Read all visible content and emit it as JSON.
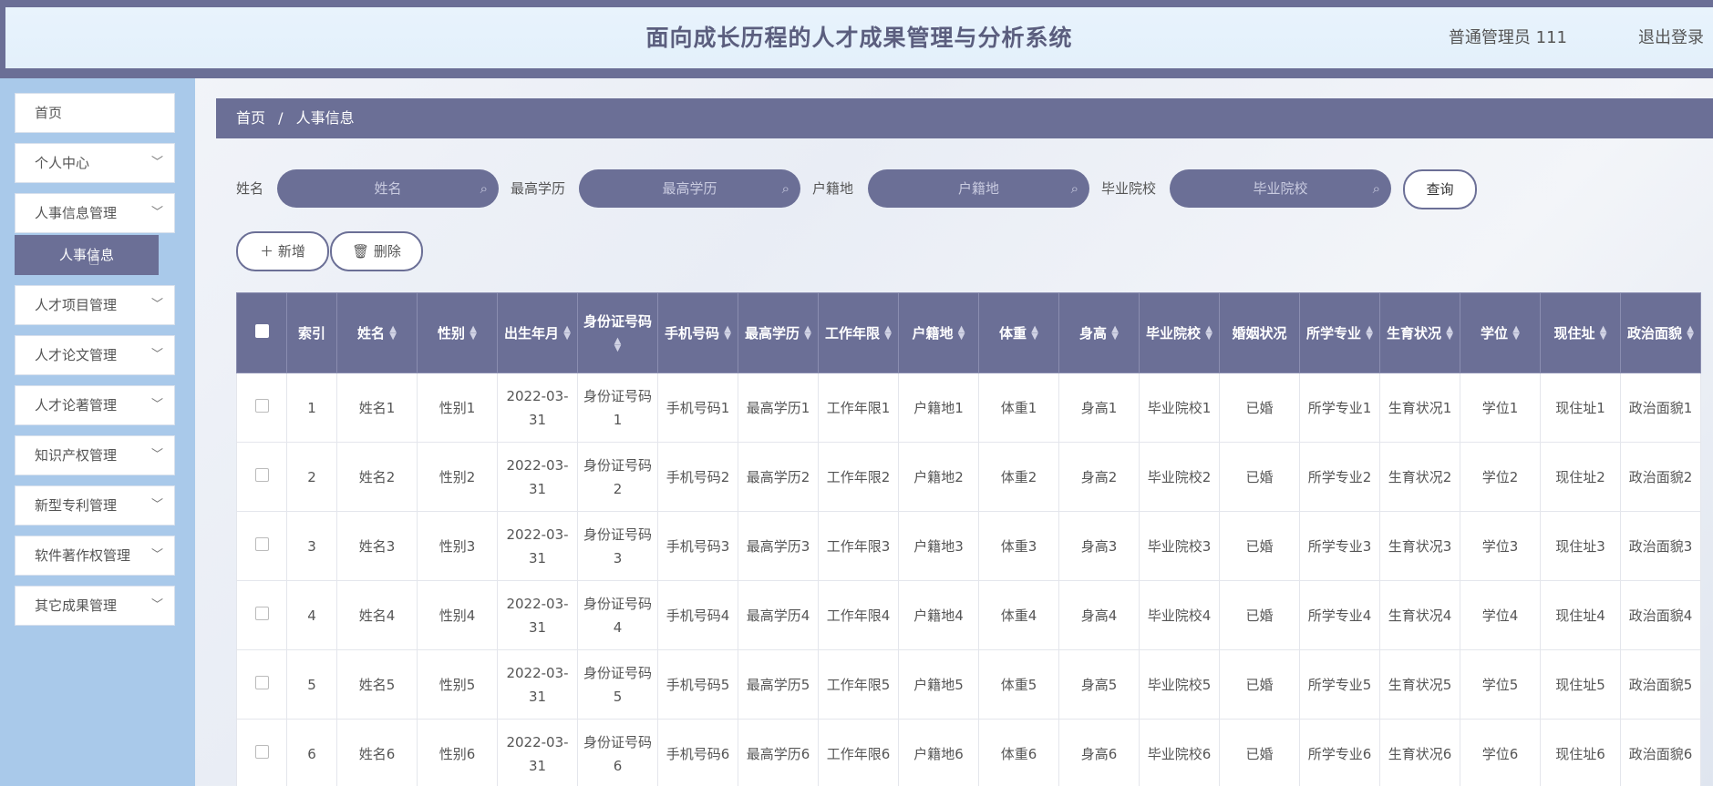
{
  "header": {
    "title": "面向成长历程的人才成果管理与分析系统",
    "user": "普通管理员 111",
    "logout": "退出登录"
  },
  "sidebar": {
    "items": [
      {
        "label": "首页",
        "expandable": false
      },
      {
        "label": "个人中心",
        "expandable": true
      },
      {
        "label": "人事信息管理",
        "expandable": true
      },
      {
        "label": "人才项目管理",
        "expandable": true
      },
      {
        "label": "人才论文管理",
        "expandable": true
      },
      {
        "label": "人才论著管理",
        "expandable": true
      },
      {
        "label": "知识产权管理",
        "expandable": true
      },
      {
        "label": "新型专利管理",
        "expandable": true
      },
      {
        "label": "软件著作权管理",
        "expandable": true
      },
      {
        "label": "其它成果管理",
        "expandable": true
      }
    ],
    "active_subitem": "人事信息"
  },
  "breadcrumb": {
    "home": "首页",
    "separator": "/",
    "current": "人事信息"
  },
  "search": {
    "fields": [
      {
        "label": "姓名",
        "placeholder": "姓名"
      },
      {
        "label": "最高学历",
        "placeholder": "最高学历"
      },
      {
        "label": "户籍地",
        "placeholder": "户籍地"
      },
      {
        "label": "毕业院校",
        "placeholder": "毕业院校"
      }
    ],
    "query_button": "查询"
  },
  "actions": {
    "add": "新增",
    "delete": "删除"
  },
  "table": {
    "columns": [
      {
        "label": "索引",
        "sortable": false
      },
      {
        "label": "姓名",
        "sortable": true
      },
      {
        "label": "性别",
        "sortable": true
      },
      {
        "label": "出生年月",
        "sortable": true
      },
      {
        "label": "身份证号码",
        "sortable": true
      },
      {
        "label": "手机号码",
        "sortable": true
      },
      {
        "label": "最高学历",
        "sortable": true
      },
      {
        "label": "工作年限",
        "sortable": true
      },
      {
        "label": "户籍地",
        "sortable": true
      },
      {
        "label": "体重",
        "sortable": true
      },
      {
        "label": "身高",
        "sortable": true
      },
      {
        "label": "毕业院校",
        "sortable": true
      },
      {
        "label": "婚姻状况",
        "sortable": false
      },
      {
        "label": "所学专业",
        "sortable": true
      },
      {
        "label": "生育状况",
        "sortable": true
      },
      {
        "label": "学位",
        "sortable": true
      },
      {
        "label": "现住址",
        "sortable": true
      },
      {
        "label": "政治面貌",
        "sortable": true
      }
    ],
    "rows": [
      [
        "1",
        "姓名1",
        "性别1",
        "2022-03-31",
        "身份证号码1",
        "手机号码1",
        "最高学历1",
        "工作年限1",
        "户籍地1",
        "体重1",
        "身高1",
        "毕业院校1",
        "已婚",
        "所学专业1",
        "生育状况1",
        "学位1",
        "现住址1",
        "政治面貌1"
      ],
      [
        "2",
        "姓名2",
        "性别2",
        "2022-03-31",
        "身份证号码2",
        "手机号码2",
        "最高学历2",
        "工作年限2",
        "户籍地2",
        "体重2",
        "身高2",
        "毕业院校2",
        "已婚",
        "所学专业2",
        "生育状况2",
        "学位2",
        "现住址2",
        "政治面貌2"
      ],
      [
        "3",
        "姓名3",
        "性别3",
        "2022-03-31",
        "身份证号码3",
        "手机号码3",
        "最高学历3",
        "工作年限3",
        "户籍地3",
        "体重3",
        "身高3",
        "毕业院校3",
        "已婚",
        "所学专业3",
        "生育状况3",
        "学位3",
        "现住址3",
        "政治面貌3"
      ],
      [
        "4",
        "姓名4",
        "性别4",
        "2022-03-31",
        "身份证号码4",
        "手机号码4",
        "最高学历4",
        "工作年限4",
        "户籍地4",
        "体重4",
        "身高4",
        "毕业院校4",
        "已婚",
        "所学专业4",
        "生育状况4",
        "学位4",
        "现住址4",
        "政治面貌4"
      ],
      [
        "5",
        "姓名5",
        "性别5",
        "2022-03-31",
        "身份证号码5",
        "手机号码5",
        "最高学历5",
        "工作年限5",
        "户籍地5",
        "体重5",
        "身高5",
        "毕业院校5",
        "已婚",
        "所学专业5",
        "生育状况5",
        "学位5",
        "现住址5",
        "政治面貌5"
      ],
      [
        "6",
        "姓名6",
        "性别6",
        "2022-03-31",
        "身份证号码6",
        "手机号码6",
        "最高学历6",
        "工作年限6",
        "户籍地6",
        "体重6",
        "身高6",
        "毕业院校6",
        "已婚",
        "所学专业6",
        "生育状况6",
        "学位6",
        "现住址6",
        "政治面貌6"
      ]
    ]
  }
}
